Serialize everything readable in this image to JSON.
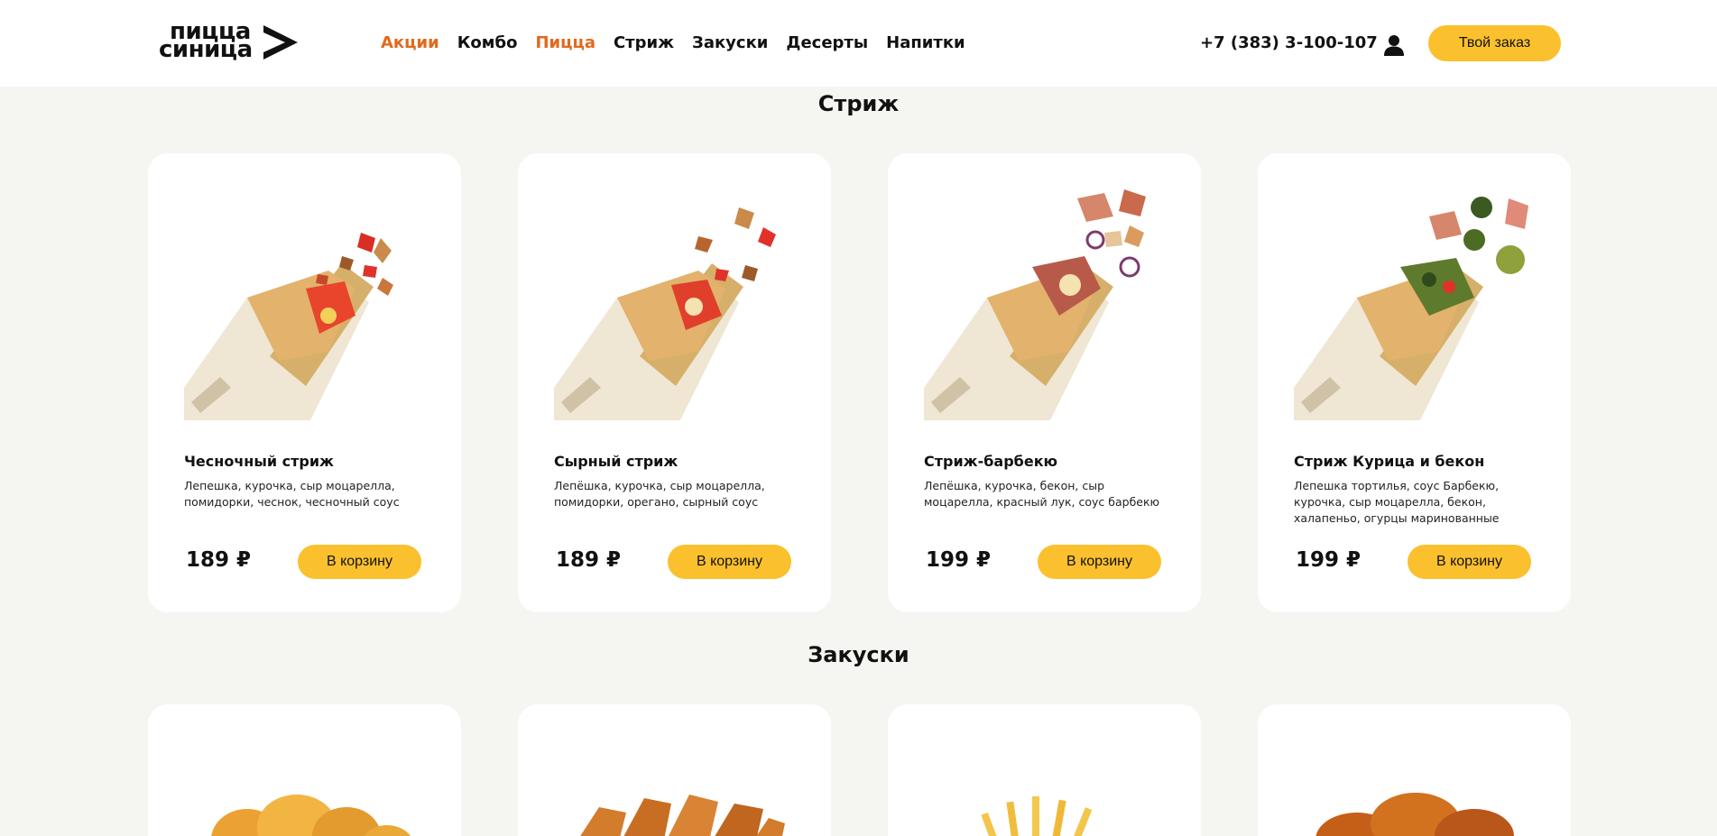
{
  "header": {
    "logo": {
      "line1": "пицца",
      "line2": "синица"
    },
    "nav": [
      {
        "label": "Акции",
        "accent": true
      },
      {
        "label": "Комбо",
        "accent": false
      },
      {
        "label": "Пицца",
        "accent": true
      },
      {
        "label": "Стриж",
        "accent": false
      },
      {
        "label": "Закуски",
        "accent": false
      },
      {
        "label": "Десерты",
        "accent": false
      },
      {
        "label": "Напитки",
        "accent": false
      }
    ],
    "phone": "+7 (383) 3-100-107",
    "user_icon": "user-icon",
    "order_button": "Твой заказ"
  },
  "colors": {
    "accent": "#e2691c",
    "button": "#fbc02d",
    "background": "#f5f5f1",
    "card": "#ffffff"
  },
  "sections": [
    {
      "title": "Стриж",
      "products": [
        {
          "name": "Чесночный стриж",
          "description": "Лепешка, курочка, сыр моцарелла, помидорки, чеснок, чесночный соус",
          "price": "189 ₽",
          "button": "В корзину"
        },
        {
          "name": "Сырный стриж",
          "description": "Лепёшка, курочка, сыр моцарелла, помидорки, орегано, сырный соус",
          "price": "189 ₽",
          "button": "В корзину"
        },
        {
          "name": "Стриж-барбекю",
          "description": "Лепёшка, курочка, бекон, сыр моцарелла, красный лук, соус барбекю",
          "price": "199 ₽",
          "button": "В корзину"
        },
        {
          "name": "Стриж Курица и бекон",
          "description": "Лепешка тортилья, соус Барбекю, курочка, сыр моцарелла, бекон, халапеньо, огурцы маринованные",
          "price": "199 ₽",
          "button": "В корзину"
        }
      ]
    },
    {
      "title": "Закуски",
      "products": []
    }
  ]
}
